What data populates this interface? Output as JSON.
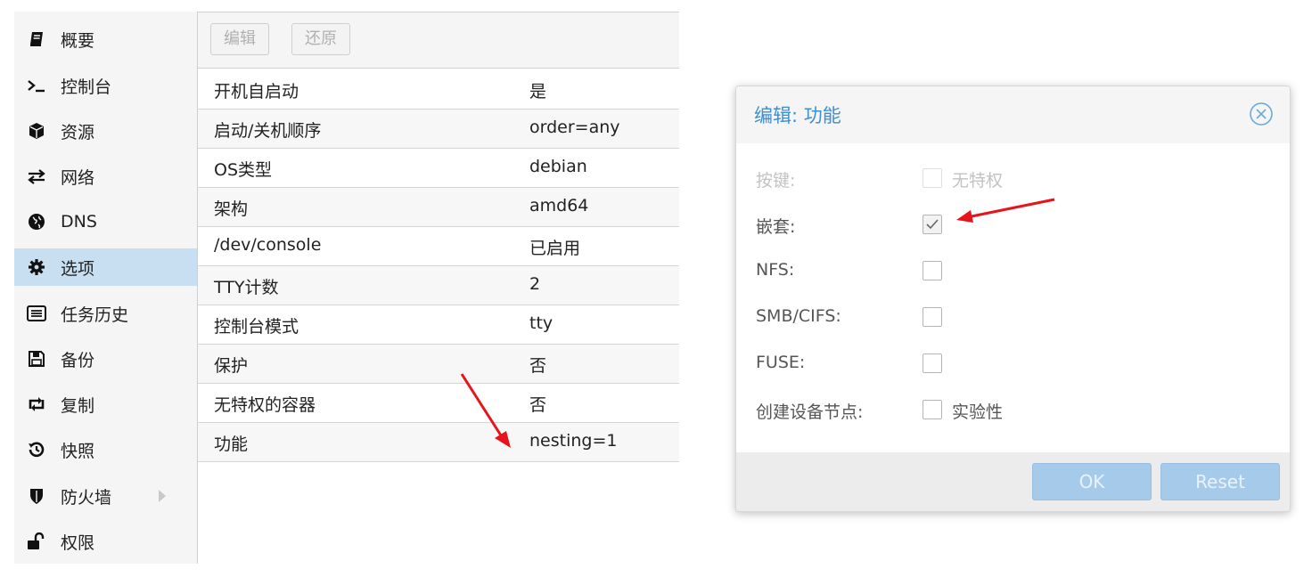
{
  "sidebar": {
    "items": [
      {
        "label": "概要",
        "icon": "book-icon"
      },
      {
        "label": "控制台",
        "icon": "terminal-icon"
      },
      {
        "label": "资源",
        "icon": "cube-icon"
      },
      {
        "label": "网络",
        "icon": "exchange-icon"
      },
      {
        "label": "DNS",
        "icon": "globe-icon"
      },
      {
        "label": "选项",
        "icon": "gear-icon"
      },
      {
        "label": "任务历史",
        "icon": "list-icon"
      },
      {
        "label": "备份",
        "icon": "floppy-icon"
      },
      {
        "label": "复制",
        "icon": "retweet-icon"
      },
      {
        "label": "快照",
        "icon": "history-icon"
      },
      {
        "label": "防火墙",
        "icon": "shield-icon"
      },
      {
        "label": "权限",
        "icon": "unlock-icon"
      }
    ],
    "selected": "选项"
  },
  "toolbar": {
    "edit_label": "编辑",
    "revert_label": "还原"
  },
  "options": {
    "rows": [
      {
        "key": "开机自启动",
        "value": "是"
      },
      {
        "key": "启动/关机顺序",
        "value": "order=any"
      },
      {
        "key": "OS类型",
        "value": "debian"
      },
      {
        "key": "架构",
        "value": "amd64"
      },
      {
        "key": "/dev/console",
        "value": "已启用"
      },
      {
        "key": "TTY计数",
        "value": "2"
      },
      {
        "key": "控制台模式",
        "value": "tty"
      },
      {
        "key": "保护",
        "value": "否"
      },
      {
        "key": "无特权的容器",
        "value": "否"
      },
      {
        "key": "功能",
        "value": "nesting=1"
      }
    ]
  },
  "dialog": {
    "title": "编辑: 功能",
    "fields": [
      {
        "label": "按键:",
        "checkbox_text": "无特权",
        "checked": false,
        "disabled": true
      },
      {
        "label": "嵌套:",
        "checkbox_text": "",
        "checked": true,
        "disabled": false
      },
      {
        "label": "NFS:",
        "checkbox_text": "",
        "checked": false,
        "disabled": false
      },
      {
        "label": "SMB/CIFS:",
        "checkbox_text": "",
        "checked": false,
        "disabled": false
      },
      {
        "label": "FUSE:",
        "checkbox_text": "",
        "checked": false,
        "disabled": false
      },
      {
        "label": "创建设备节点:",
        "checkbox_text": "实验性",
        "checked": false,
        "disabled": false
      }
    ],
    "ok_label": "OK",
    "reset_label": "Reset"
  },
  "colors": {
    "accent": "#3d8ed3",
    "selected_bg": "#c8dff1",
    "button_disabled_bg": "#a6cbea",
    "annotation_arrow": "#e8141c"
  }
}
